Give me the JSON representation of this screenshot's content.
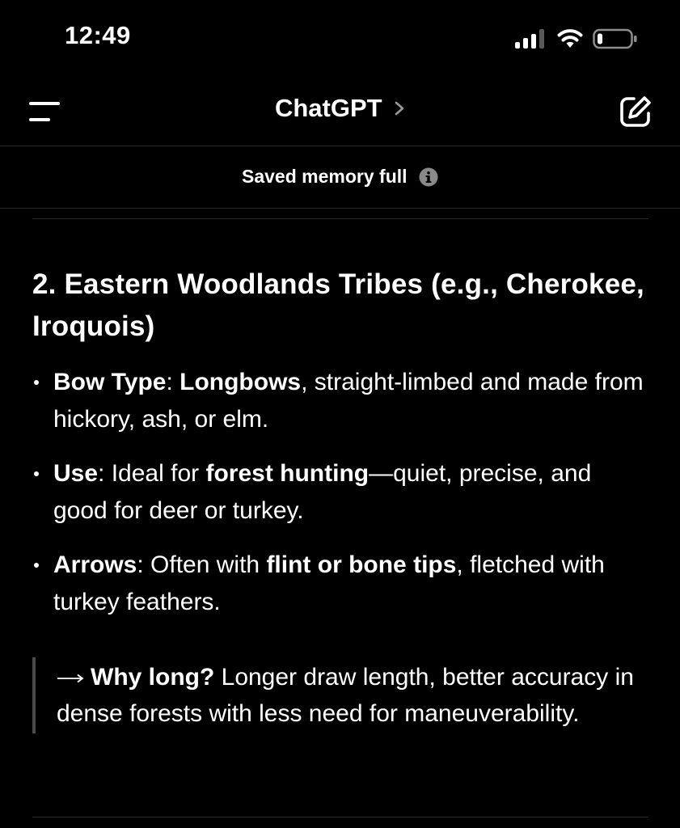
{
  "status_bar": {
    "time": "12:49"
  },
  "nav": {
    "title": "ChatGPT",
    "menu_icon": "menu-icon",
    "chevron_icon": "chevron-right-icon",
    "compose_icon": "compose-icon"
  },
  "banner": {
    "text": "Saved memory full",
    "icon": "info-icon"
  },
  "content": {
    "heading": "2. Eastern Woodlands Tribes (e.g., Cherokee, Iroquois)",
    "bullets": [
      {
        "label": "Bow Type",
        "sep": ": ",
        "bold_value": "Longbows",
        "rest": ", straight-limbed and made from hickory, ash, or elm."
      },
      {
        "label": "Use",
        "sep": ": Ideal for ",
        "bold_value": "forest hunting",
        "rest": "—quiet, precise, and good for deer or turkey."
      },
      {
        "label": "Arrows",
        "sep": ": Often with ",
        "bold_value": "flint or bone tips",
        "rest": ", fletched with turkey feathers."
      }
    ],
    "quote": {
      "bold": "Why long?",
      "text": " Longer draw length, better accuracy in dense forests with less need for maneuverability."
    }
  },
  "colors": {
    "background": "#000000",
    "text": "#ffffff",
    "divider": "#2a2a2a",
    "quote_bar": "#4a4a4a"
  }
}
